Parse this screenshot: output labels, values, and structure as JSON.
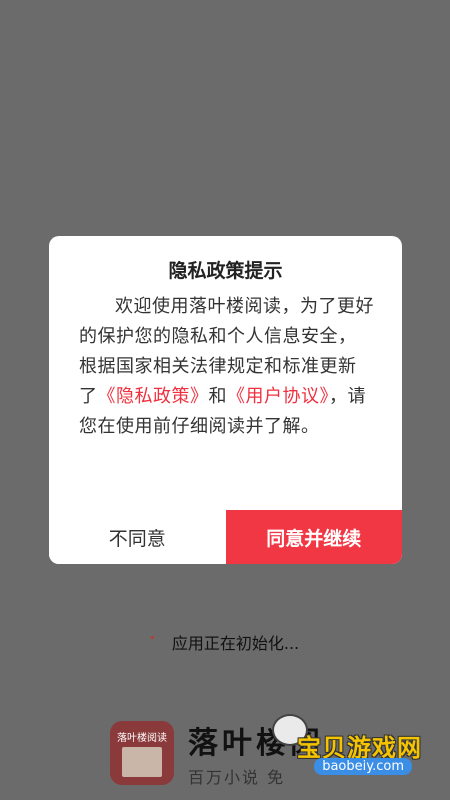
{
  "dialog": {
    "title": "隐私政策提示",
    "body_prefix": "欢迎使用落叶楼阅读，为了更好的保护您的隐私和个人信息安全，根据国家相关法律规定和标准更新了",
    "privacy_link": "《隐私政策》",
    "and": "和",
    "agreement_link": "《用户协议》",
    "body_suffix": "，请您在使用前仔细阅读并了解。",
    "disagree_label": "不同意",
    "agree_label": "同意并继续"
  },
  "status": {
    "init_text": "应用正在初始化..."
  },
  "brand": {
    "logo_text": "落叶楼阅读",
    "name": "落叶楼阅",
    "slogan": "百万小说 免"
  },
  "watermark": {
    "text": "宝贝游戏网",
    "url": "baobeiy.com"
  },
  "colors": {
    "overlay": "#6b6b6b",
    "accent": "#f23744",
    "link": "#f0303f"
  }
}
